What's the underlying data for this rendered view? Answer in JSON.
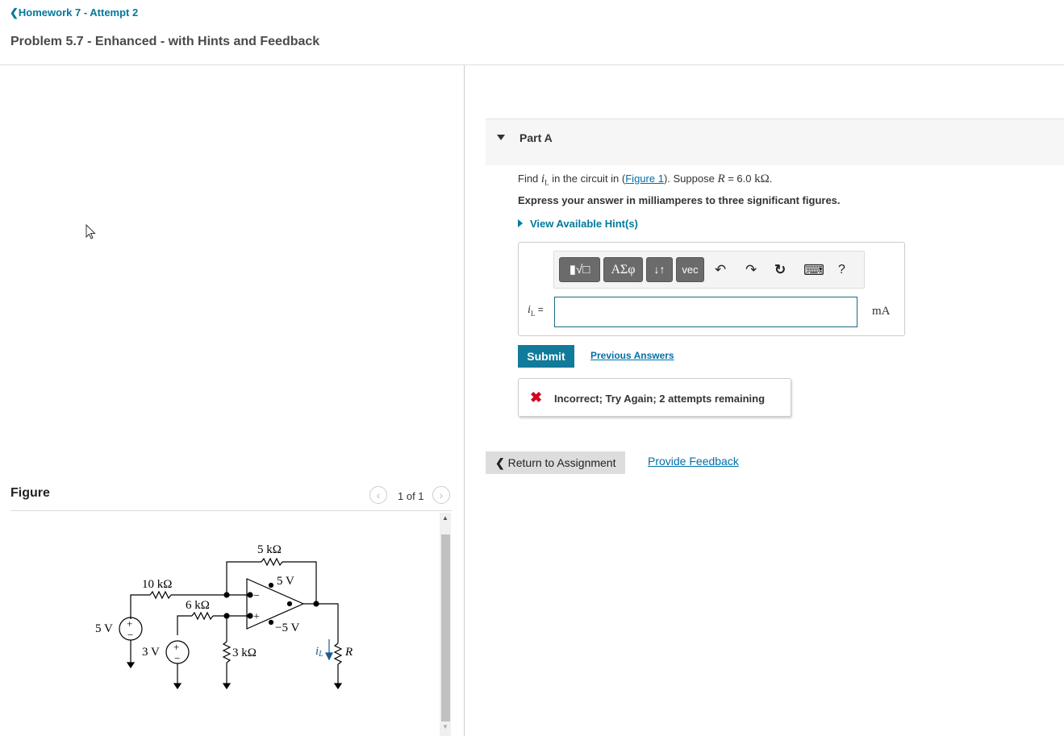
{
  "header": {
    "back_link": "Homework 7 - Attempt 2",
    "title": "Problem 5.7 - Enhanced - with Hints and Feedback"
  },
  "figure": {
    "label": "Figure",
    "pager": "1 of 1",
    "circuit": {
      "r_feedback": "5 kΩ",
      "r1": "10 kΩ",
      "r2": "6 kΩ",
      "r3": "3 kΩ",
      "v1": "5 V",
      "v2": "3 V",
      "vpos": "5 V",
      "vneg": "−5 V",
      "load": "R",
      "current": "i",
      "current_sub": "L",
      "plus": "+",
      "minus": "−"
    }
  },
  "part_a": {
    "title": "Part A",
    "question_pre": "Find ",
    "var_main": "i",
    "var_sub": "L",
    "question_mid": " in the circuit in (",
    "figure_link": "Figure 1",
    "question_mid2": "). Suppose ",
    "r_var": "R",
    "r_value": " = 6.0 ",
    "r_unit": "kΩ",
    "question_end": ".",
    "instruction": "Express your answer in milliamperes to three significant figures.",
    "hints_link": "View Available Hint(s)",
    "toolbar": {
      "templates": "▮√□",
      "greek": "ΑΣφ",
      "arrows": "↓↑",
      "vec": "vec",
      "undo": "↶",
      "redo": "↷",
      "reset": "↻",
      "keyboard": "⌨",
      "help": "?"
    },
    "answer_label_main": "i",
    "answer_label_sub": "L",
    "answer_label_eq": " =",
    "answer_value": "",
    "unit": "mA",
    "submit": "Submit",
    "previous_answers": "Previous Answers",
    "feedback": "Incorrect; Try Again; 2 attempts remaining",
    "feedback_icon": "✖"
  },
  "footer": {
    "return_button": "Return to Assignment",
    "provide_feedback": "Provide Feedback"
  }
}
